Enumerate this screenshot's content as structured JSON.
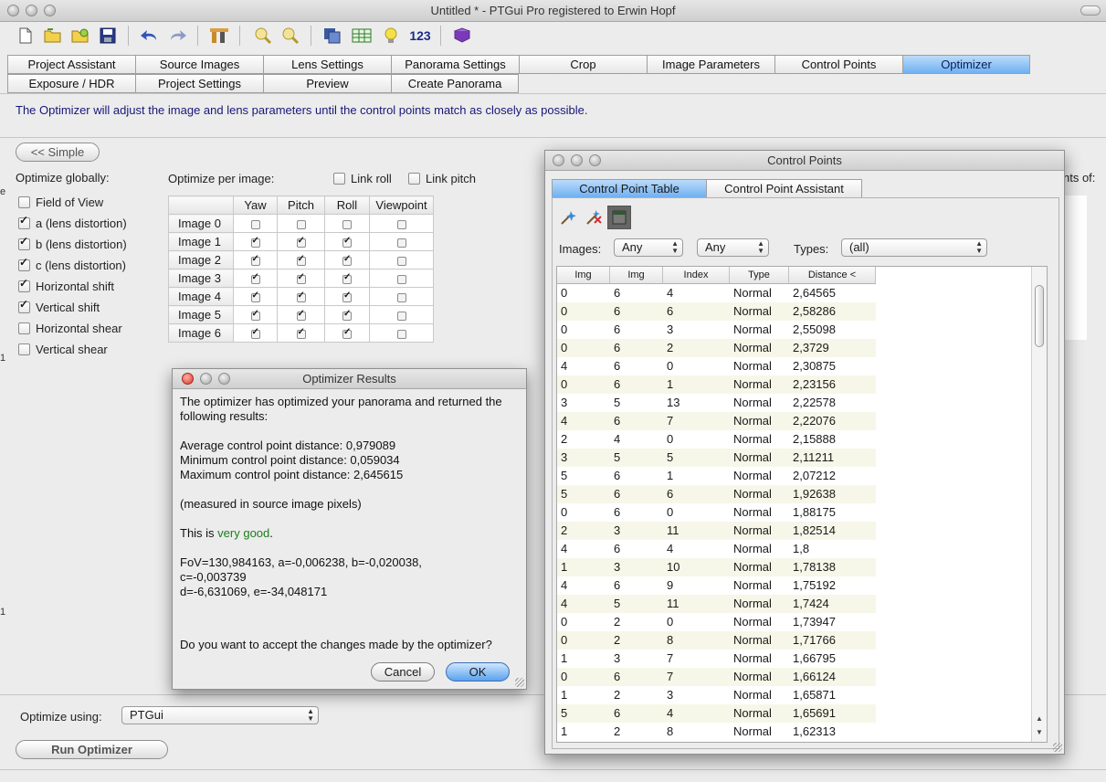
{
  "window": {
    "title": "Untitled * - PTGui Pro registered to Erwin Hopf"
  },
  "toolbar": {
    "icons": [
      "new-icon",
      "open-icon",
      "open-recent-icon",
      "save-icon",
      "undo-icon",
      "redo-icon",
      "tools-icon",
      "zoom-in-icon",
      "zoom-out-icon",
      "copy-panel-icon",
      "table-icon",
      "lightbulb-icon",
      "numbering-icon",
      "book-icon"
    ],
    "numbering_label": "123"
  },
  "tabs": {
    "row1": [
      "Project Assistant",
      "Source Images",
      "Lens Settings",
      "Panorama Settings",
      "Crop",
      "Image Parameters",
      "Control Points",
      "Optimizer"
    ],
    "row2": [
      "Exposure / HDR",
      "Project Settings",
      "Preview",
      "Create Panorama"
    ],
    "active": "Optimizer"
  },
  "info_text": "The Optimizer will adjust the image and lens parameters until the control points match as closely as possible.",
  "simple_button": "<< Simple",
  "optimize_globally": {
    "label": "Optimize globally:",
    "items": [
      {
        "label": "Field of View",
        "checked": false
      },
      {
        "label": "a (lens distortion)",
        "checked": true
      },
      {
        "label": "b (lens distortion)",
        "checked": true
      },
      {
        "label": "c (lens distortion)",
        "checked": true
      },
      {
        "label": "Horizontal shift",
        "checked": true
      },
      {
        "label": "Vertical shift",
        "checked": true
      },
      {
        "label": "Horizontal shear",
        "checked": false
      },
      {
        "label": "Vertical shear",
        "checked": false
      }
    ]
  },
  "per_image": {
    "label": "Optimize per image:",
    "link_roll": "Link roll",
    "link_pitch": "Link pitch",
    "columns": [
      "Yaw",
      "Pitch",
      "Roll",
      "Viewpoint"
    ],
    "rows": [
      {
        "name": "Image 0",
        "yaw": false,
        "pitch": false,
        "roll": false,
        "viewpoint": false
      },
      {
        "name": "Image 1",
        "yaw": true,
        "pitch": true,
        "roll": true,
        "viewpoint": false
      },
      {
        "name": "Image 2",
        "yaw": true,
        "pitch": true,
        "roll": true,
        "viewpoint": false
      },
      {
        "name": "Image 3",
        "yaw": true,
        "pitch": true,
        "roll": true,
        "viewpoint": false
      },
      {
        "name": "Image 4",
        "yaw": true,
        "pitch": true,
        "roll": true,
        "viewpoint": false
      },
      {
        "name": "Image 5",
        "yaw": true,
        "pitch": true,
        "roll": true,
        "viewpoint": false
      },
      {
        "name": "Image 6",
        "yaw": true,
        "pitch": true,
        "roll": true,
        "viewpoint": false
      }
    ]
  },
  "partial_text": {
    "nts_of": "nts of:"
  },
  "optimize_using": {
    "label": "Optimize using:",
    "value": "PTGui"
  },
  "run_button": "Run Optimizer",
  "control_points_window": {
    "title": "Control Points",
    "tabs": [
      "Control Point Table",
      "Control Point Assistant"
    ],
    "images_label": "Images:",
    "images_filter1": "Any",
    "images_filter2": "Any",
    "types_label": "Types:",
    "types_value": "(all)",
    "columns": [
      "Img",
      "Img",
      "Index",
      "Type",
      "Distance <"
    ],
    "rows": [
      [
        "0",
        "6",
        "4",
        "Normal",
        "2,64565"
      ],
      [
        "0",
        "6",
        "6",
        "Normal",
        "2,58286"
      ],
      [
        "0",
        "6",
        "3",
        "Normal",
        "2,55098"
      ],
      [
        "0",
        "6",
        "2",
        "Normal",
        "2,3729"
      ],
      [
        "4",
        "6",
        "0",
        "Normal",
        "2,30875"
      ],
      [
        "0",
        "6",
        "1",
        "Normal",
        "2,23156"
      ],
      [
        "3",
        "5",
        "13",
        "Normal",
        "2,22578"
      ],
      [
        "4",
        "6",
        "7",
        "Normal",
        "2,22076"
      ],
      [
        "2",
        "4",
        "0",
        "Normal",
        "2,15888"
      ],
      [
        "3",
        "5",
        "5",
        "Normal",
        "2,11211"
      ],
      [
        "5",
        "6",
        "1",
        "Normal",
        "2,07212"
      ],
      [
        "5",
        "6",
        "6",
        "Normal",
        "1,92638"
      ],
      [
        "0",
        "6",
        "0",
        "Normal",
        "1,88175"
      ],
      [
        "2",
        "3",
        "11",
        "Normal",
        "1,82514"
      ],
      [
        "4",
        "6",
        "4",
        "Normal",
        "1,8"
      ],
      [
        "1",
        "3",
        "10",
        "Normal",
        "1,78138"
      ],
      [
        "4",
        "6",
        "9",
        "Normal",
        "1,75192"
      ],
      [
        "4",
        "5",
        "11",
        "Normal",
        "1,7424"
      ],
      [
        "0",
        "2",
        "0",
        "Normal",
        "1,73947"
      ],
      [
        "0",
        "2",
        "8",
        "Normal",
        "1,71766"
      ],
      [
        "1",
        "3",
        "7",
        "Normal",
        "1,66795"
      ],
      [
        "0",
        "6",
        "7",
        "Normal",
        "1,66124"
      ],
      [
        "1",
        "2",
        "3",
        "Normal",
        "1,65871"
      ],
      [
        "5",
        "6",
        "4",
        "Normal",
        "1,65691"
      ],
      [
        "1",
        "2",
        "8",
        "Normal",
        "1,62313"
      ]
    ]
  },
  "optimizer_results": {
    "title": "Optimizer Results",
    "intro": "The optimizer has optimized your panorama and returned the following results:",
    "average": "Average control point distance: 0,979089",
    "minimum": "Minimum control point distance: 0,059034",
    "maximum": "Maximum control point distance: 2,645615",
    "measured": "(measured in source image pixels)",
    "quality_prefix": "This is ",
    "quality": "very good",
    "quality_suffix": ".",
    "params_line1": "FoV=130,984163, a=-0,006238, b=-0,020038,",
    "params_line2": "c=-0,003739",
    "params_line3": "d=-6,631069, e=-34,048171",
    "question": "Do you want to accept the changes made by the optimizer?",
    "cancel": "Cancel",
    "ok": "OK"
  },
  "colors": {
    "active_tab": "#6fb0f2",
    "info_text": "#17177a",
    "good": "#1d7d1d"
  }
}
